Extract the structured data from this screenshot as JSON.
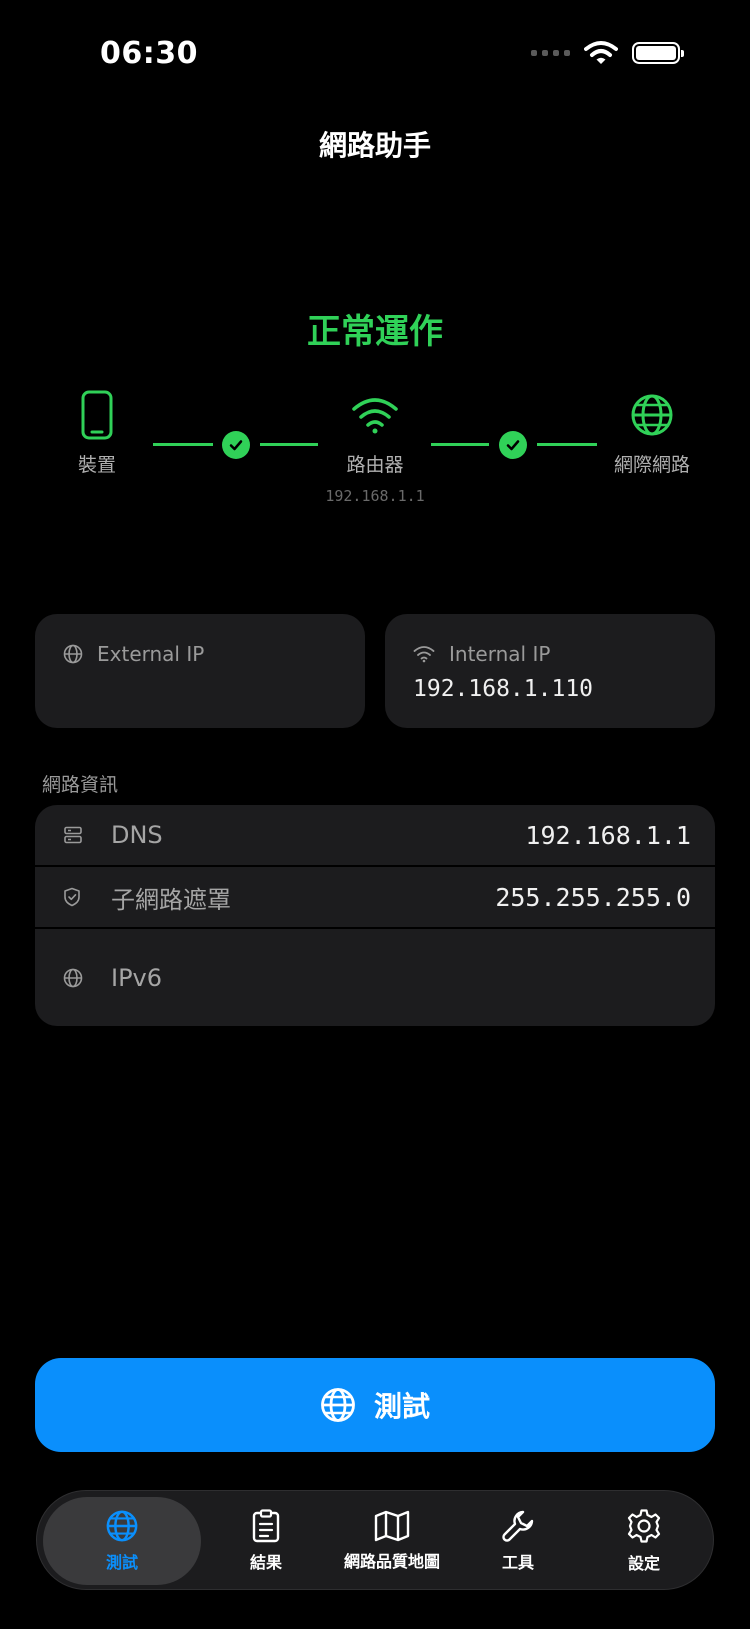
{
  "status_bar": {
    "time": "06:30"
  },
  "nav": {
    "title": "網路助手"
  },
  "connection": {
    "status": "正常運作",
    "nodes": [
      {
        "label": "裝置",
        "icon": "phone-icon"
      },
      {
        "label": "路由器",
        "sub": "192.168.1.1",
        "icon": "wifi-icon"
      },
      {
        "label": "網際網路",
        "icon": "globe-icon"
      }
    ]
  },
  "ip_cards": {
    "external": {
      "label": "External IP",
      "value": ""
    },
    "internal": {
      "label": "Internal IP",
      "value": "192.168.1.110"
    }
  },
  "network_info": {
    "section_title": "網路資訊",
    "rows": [
      {
        "key": "DNS",
        "value": "192.168.1.1",
        "icon": "server-icon"
      },
      {
        "key": "子網路遮罩",
        "value": "255.255.255.0",
        "icon": "shield-icon"
      },
      {
        "key": "IPv6",
        "value": "",
        "icon": "globe-icon"
      }
    ]
  },
  "test_button": {
    "label": "測試"
  },
  "tabs": [
    {
      "label": "測試",
      "icon": "globe-icon",
      "active": true
    },
    {
      "label": "結果",
      "icon": "clipboard-icon"
    },
    {
      "label": "網路品質地圖",
      "icon": "map-icon"
    },
    {
      "label": "工具",
      "icon": "wrench-icon"
    },
    {
      "label": "設定",
      "icon": "gear-icon"
    }
  ],
  "colors": {
    "accent": "#0A8FFC",
    "ok": "#30D158",
    "card": "#1C1C1E"
  }
}
